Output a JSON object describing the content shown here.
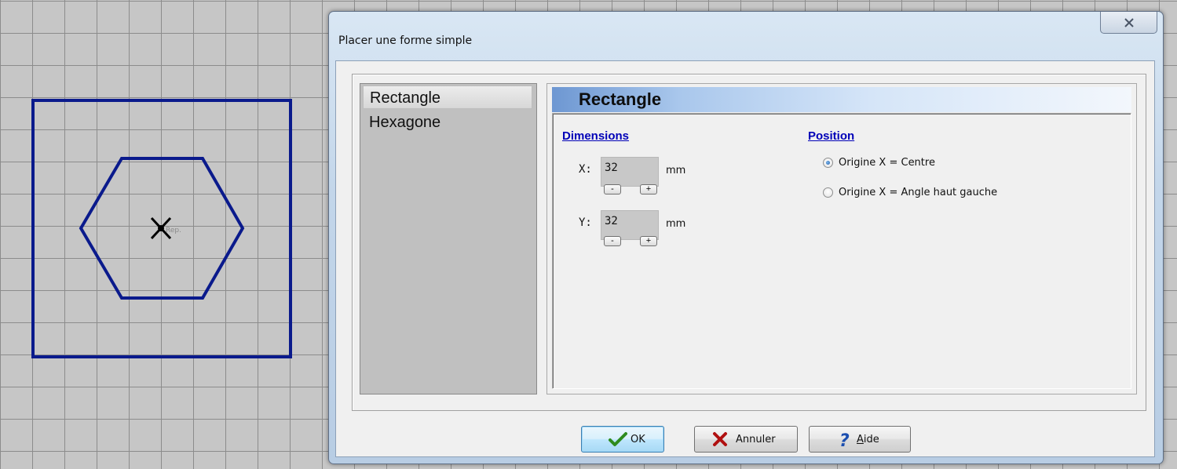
{
  "dialog": {
    "title": "Placer une forme simple",
    "close_icon": "close-x-icon"
  },
  "canvas": {
    "marker_label": "Rep."
  },
  "shapes": {
    "items": [
      {
        "label": "Rectangle",
        "selected": true
      },
      {
        "label": "Hexagone",
        "selected": false
      }
    ]
  },
  "panel": {
    "header": "Rectangle",
    "dimensions": {
      "label": "Dimensions",
      "x_label": "X:",
      "x_value": "32",
      "y_label": "Y:",
      "y_value": "32",
      "unit": "mm",
      "decrement_label": "-",
      "increment_label": "+"
    },
    "position": {
      "label": "Position",
      "options": [
        {
          "label": "Origine X = Centre",
          "checked": true
        },
        {
          "label": "Origine X = Angle haut gauche",
          "checked": false
        }
      ]
    }
  },
  "buttons": {
    "ok": "OK",
    "cancel": "Annuler",
    "help": "Aide"
  },
  "colors": {
    "shape_stroke": "#0a1a8c",
    "grid_line": "#8c8c8c",
    "canvas_bg": "#c6c6c6",
    "link_blue": "#0000b8",
    "ok_check": "#2e8b1e",
    "cancel_x": "#b01010",
    "help_question": "#1c4fb0"
  }
}
